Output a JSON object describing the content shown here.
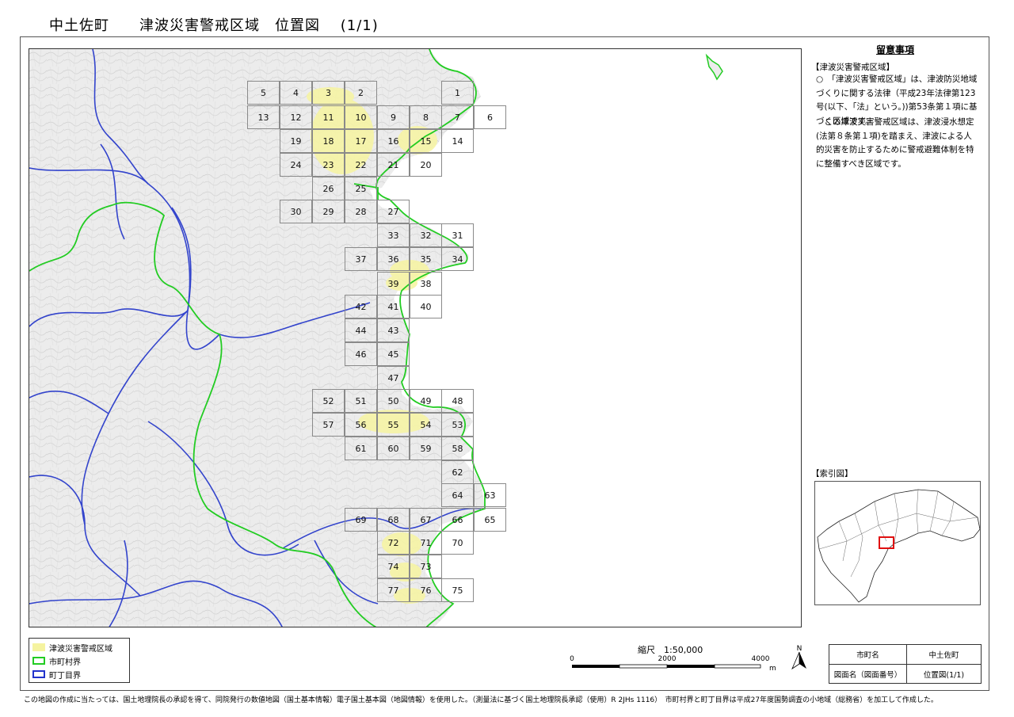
{
  "title": "中土佐町　　津波災害警戒区域　位置図　 (1/1)",
  "notes": {
    "title": "留意事項",
    "heading": "【津波災害警戒区域】",
    "para1": "○　「津波災害警戒区域」は、津波防災地域づくりに関する法律（平成23年法律第123号(以下、「法」という。))第53条第１項に基づく区域です。",
    "para2": "　この津波災害警戒区域は、津波浸水想定(法第８条第１項)を踏まえ、津波による人的災害を防止するために警戒避難体制を特に整備すべき区域です。"
  },
  "index_map": {
    "label": "【索引図】"
  },
  "legend": {
    "items": [
      {
        "label": "津波災害警戒区域",
        "color": "#f5f3a0"
      },
      {
        "label": "市町村界",
        "color": "#22cc22"
      },
      {
        "label": "町丁目界",
        "color": "#2233cc"
      }
    ]
  },
  "scale": {
    "label": "縮尺　1:50,000",
    "ticks": [
      "0",
      "2000",
      "4000"
    ],
    "unit": "m"
  },
  "north_arrow": {
    "label": "N"
  },
  "info_table": {
    "header_left": "市町名",
    "header_right": "中土佐町",
    "row_left": "図面名（図面番号）",
    "row_right": "位置図(1/1)"
  },
  "map_tiles": [
    {
      "n": "1"
    },
    {
      "n": "2"
    },
    {
      "n": "3"
    },
    {
      "n": "4"
    },
    {
      "n": "5"
    },
    {
      "n": "6"
    },
    {
      "n": "7"
    },
    {
      "n": "8"
    },
    {
      "n": "9"
    },
    {
      "n": "10"
    },
    {
      "n": "11"
    },
    {
      "n": "12"
    },
    {
      "n": "13"
    },
    {
      "n": "14"
    },
    {
      "n": "15"
    },
    {
      "n": "16"
    },
    {
      "n": "17"
    },
    {
      "n": "18"
    },
    {
      "n": "19"
    },
    {
      "n": "20"
    },
    {
      "n": "21"
    },
    {
      "n": "22"
    },
    {
      "n": "23"
    },
    {
      "n": "24"
    },
    {
      "n": "25"
    },
    {
      "n": "26"
    },
    {
      "n": "27"
    },
    {
      "n": "28"
    },
    {
      "n": "29"
    },
    {
      "n": "30"
    },
    {
      "n": "31"
    },
    {
      "n": "32"
    },
    {
      "n": "33"
    },
    {
      "n": "34"
    },
    {
      "n": "35"
    },
    {
      "n": "36"
    },
    {
      "n": "37"
    },
    {
      "n": "38"
    },
    {
      "n": "39"
    },
    {
      "n": "40"
    },
    {
      "n": "41"
    },
    {
      "n": "42"
    },
    {
      "n": "43"
    },
    {
      "n": "44"
    },
    {
      "n": "45"
    },
    {
      "n": "46"
    },
    {
      "n": "47"
    },
    {
      "n": "48"
    },
    {
      "n": "49"
    },
    {
      "n": "50"
    },
    {
      "n": "51"
    },
    {
      "n": "52"
    },
    {
      "n": "53"
    },
    {
      "n": "54"
    },
    {
      "n": "55"
    },
    {
      "n": "56"
    },
    {
      "n": "57"
    },
    {
      "n": "58"
    },
    {
      "n": "59"
    },
    {
      "n": "60"
    },
    {
      "n": "61"
    },
    {
      "n": "62"
    },
    {
      "n": "63"
    },
    {
      "n": "64"
    },
    {
      "n": "65"
    },
    {
      "n": "66"
    },
    {
      "n": "67"
    },
    {
      "n": "68"
    },
    {
      "n": "69"
    },
    {
      "n": "70"
    },
    {
      "n": "71"
    },
    {
      "n": "72"
    },
    {
      "n": "73"
    },
    {
      "n": "74"
    },
    {
      "n": "75"
    },
    {
      "n": "76"
    },
    {
      "n": "77"
    }
  ],
  "footer": "この地図の作成に当たっては、国土地理院長の承認を得て、同院発行の数値地図（国土基本情報）電子国土基本図（地図情報）を使用した。（測量法に基づく国土地理院長承認（使用）R 2JHs 1116）　市町村界と町丁目界は平成27年度国勢調査の小地域（総務省）を加工して作成した。"
}
